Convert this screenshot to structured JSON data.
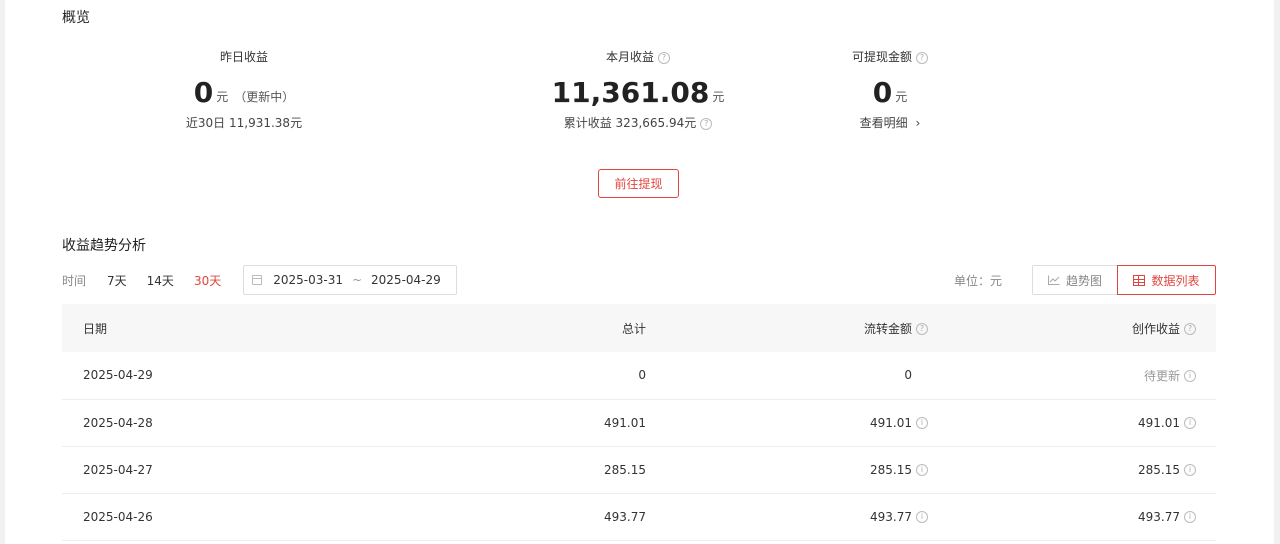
{
  "overview": {
    "title": "概览",
    "yesterday": {
      "label": "昨日收益",
      "value": "0",
      "unit": "元",
      "note": "（更新中）",
      "sub": "近30日 11,931.38元"
    },
    "month": {
      "label": "本月收益",
      "value": "11,361.08",
      "unit": "元",
      "sub": "累计收益 323,665.94元"
    },
    "withdrawable": {
      "label": "可提现金额",
      "value": "0",
      "unit": "元",
      "link": "查看明细",
      "link_arrow": "›"
    },
    "withdraw_button": "前往提现"
  },
  "trend": {
    "title": "收益趋势分析",
    "time_label": "时间",
    "ranges": [
      "7天",
      "14天",
      "30天"
    ],
    "active_range": "30天",
    "date_start": "2025-03-31",
    "date_sep": "~",
    "date_end": "2025-04-29",
    "unit_label": "单位：元",
    "trend_button": "趋势图",
    "table_button": "数据列表"
  },
  "table": {
    "columns": [
      "日期",
      "总计",
      "流转金额",
      "创作收益"
    ],
    "rows": [
      {
        "date": "2025-04-29",
        "total": "0",
        "flow": "0",
        "creation": "待更新"
      },
      {
        "date": "2025-04-28",
        "total": "491.01",
        "flow": "491.01",
        "creation": "491.01"
      },
      {
        "date": "2025-04-27",
        "total": "285.15",
        "flow": "285.15",
        "creation": "285.15"
      },
      {
        "date": "2025-04-26",
        "total": "493.77",
        "flow": "493.77",
        "creation": "493.77"
      }
    ]
  },
  "icons": {
    "help": "help-circle-icon",
    "info": "info-circle-icon",
    "calendar": "calendar-icon",
    "trend": "line-chart-icon",
    "table": "table-icon"
  },
  "colors": {
    "accent": "#e0463f",
    "text": "#222222",
    "muted": "#888888",
    "header_bg": "#f7f7f7"
  }
}
